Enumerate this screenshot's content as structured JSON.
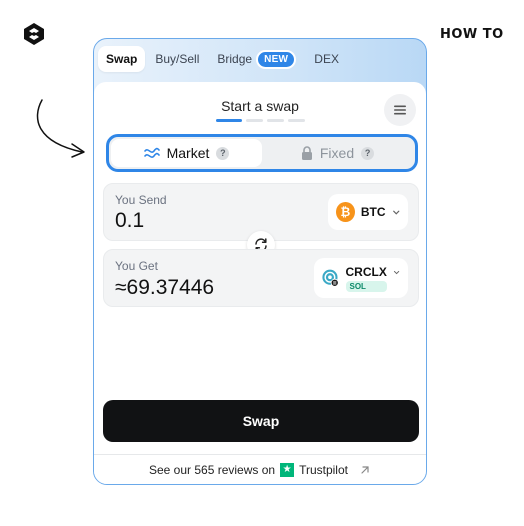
{
  "page": {
    "how_to_label": "HOW TO"
  },
  "widget": {
    "tabs": [
      {
        "label": "Swap",
        "active": true
      },
      {
        "label": "Buy/Sell",
        "active": false
      },
      {
        "label": "Bridge",
        "active": false,
        "badge": "NEW"
      },
      {
        "label": "DEX",
        "active": false
      }
    ],
    "title": "Start a swap",
    "progress_steps": 4,
    "progress_current": 1,
    "modes": {
      "market": {
        "label": "Market",
        "help": "?",
        "selected": true
      },
      "fixed": {
        "label": "Fixed",
        "help": "?",
        "selected": false
      }
    },
    "send": {
      "label": "You Send",
      "value": "0.1",
      "coin": {
        "ticker": "BTC",
        "icon": "bitcoin-icon",
        "color": "#f7931a"
      }
    },
    "get": {
      "label": "You Get",
      "value": "≈69.37446",
      "coin": {
        "ticker": "CRCLX",
        "network": "SOL",
        "icon": "crclx-token-icon"
      }
    },
    "swap_button_label": "Swap",
    "footer": {
      "reviews_text": "See our 565 reviews on",
      "brand": "Trustpilot"
    }
  },
  "colors": {
    "accent": "#2f86e7",
    "button": "#111214",
    "trustpilot": "#00b67a"
  }
}
